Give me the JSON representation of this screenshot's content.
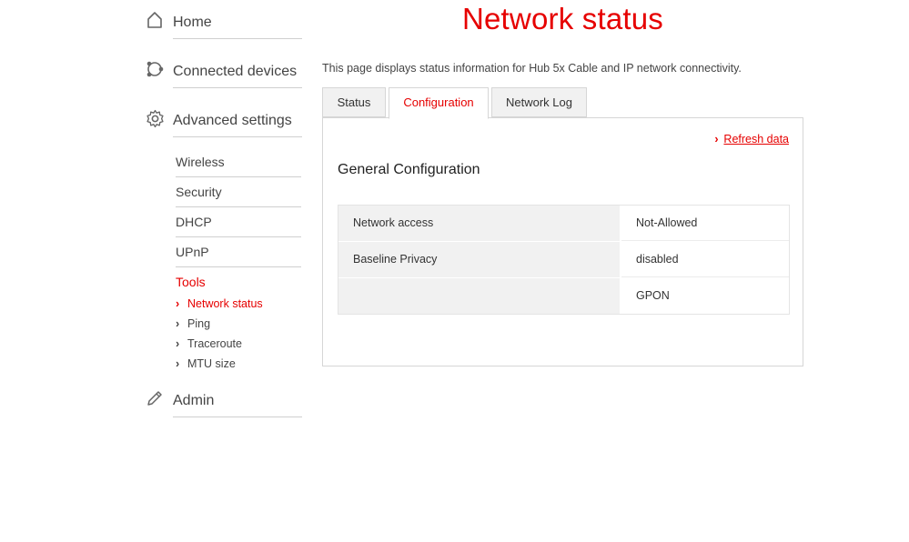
{
  "sidebar": {
    "home": "Home",
    "connected_devices": "Connected devices",
    "advanced_settings": "Advanced settings",
    "sub_items": [
      "Wireless",
      "Security",
      "DHCP",
      "UPnP",
      "Tools"
    ],
    "tools": [
      "Network status",
      "Ping",
      "Traceroute",
      "MTU size"
    ],
    "admin": "Admin"
  },
  "main": {
    "title": "Network status",
    "intro": "This page displays status information for Hub 5x Cable and IP network connectivity.",
    "tabs": [
      "Status",
      "Configuration",
      "Network Log"
    ],
    "active_tab": "Configuration",
    "refresh_label": "Refresh data",
    "section_title": "General Configuration",
    "rows": [
      {
        "label": "Network access",
        "value": "Not-Allowed"
      },
      {
        "label": "Baseline Privacy",
        "value": "disabled"
      },
      {
        "label": "",
        "value": "GPON"
      }
    ]
  },
  "colors": {
    "accent": "#e60000",
    "text": "#444444"
  }
}
